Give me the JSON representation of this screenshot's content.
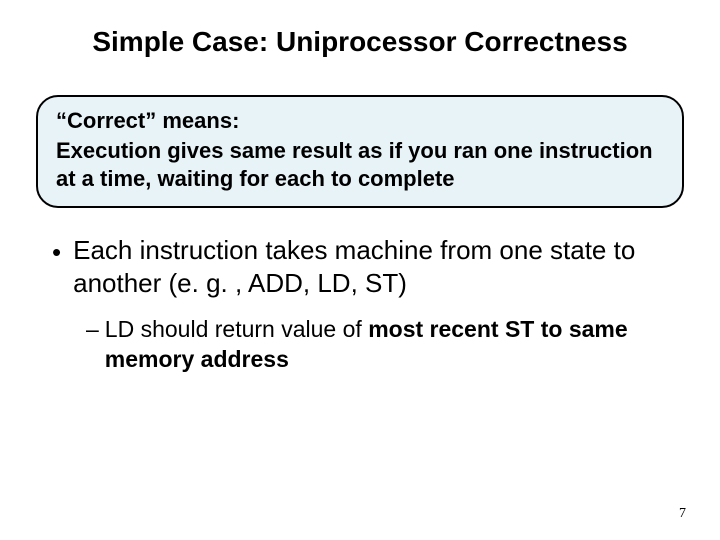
{
  "title": "Simple Case: Uniprocessor Correctness",
  "callout": {
    "line1": "“Correct” means:",
    "line2": "Execution gives same result as if you ran one instruction at a time, waiting for each to complete"
  },
  "bullet": {
    "dot": "•",
    "text": "Each instruction takes machine from one state to another (e. g. , ADD, LD, ST)"
  },
  "sub": {
    "dash": "–",
    "t1": "LD should return value of ",
    "t2": "most recent ST to same memory address"
  },
  "page": "7"
}
